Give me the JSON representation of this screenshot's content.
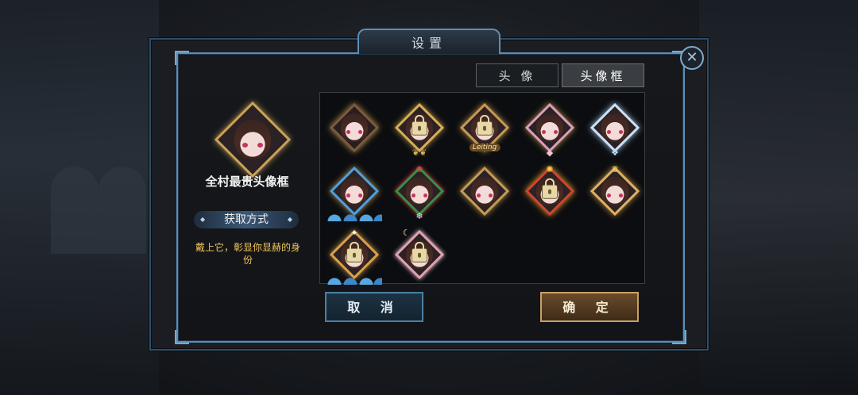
{
  "dialog": {
    "title": "设置"
  },
  "preview": {
    "frame_name": "全村最贵头像框",
    "obtain_label": "获取方式",
    "description": "戴上它，彰显你显赫的身份"
  },
  "tabs": [
    {
      "label": "头 像",
      "active": false
    },
    {
      "label": "头像框",
      "active": true
    }
  ],
  "grid": {
    "items": [
      {
        "locked": false,
        "style": "plain-brown"
      },
      {
        "locked": true,
        "style": "gold-laurel"
      },
      {
        "locked": true,
        "style": "leiting",
        "ribbon": "Leiting"
      },
      {
        "locked": false,
        "style": "pink-gem"
      },
      {
        "locked": false,
        "style": "silver-wings"
      },
      {
        "locked": false,
        "style": "ocean-wave"
      },
      {
        "locked": false,
        "style": "christmas-wreath"
      },
      {
        "locked": false,
        "style": "gold-base"
      },
      {
        "locked": true,
        "style": "fireworks"
      },
      {
        "locked": false,
        "style": "crown"
      },
      {
        "locked": true,
        "style": "tropical"
      },
      {
        "locked": true,
        "style": "moon-night"
      }
    ]
  },
  "buttons": {
    "cancel_label": "取 消",
    "confirm_label": "确 定"
  },
  "colors": {
    "accent_blue": "#5a8fb8",
    "accent_gold": "#c9a063",
    "description_text": "#f1c45a"
  },
  "icons": {
    "close": "close-icon",
    "lock": "lock-icon"
  }
}
